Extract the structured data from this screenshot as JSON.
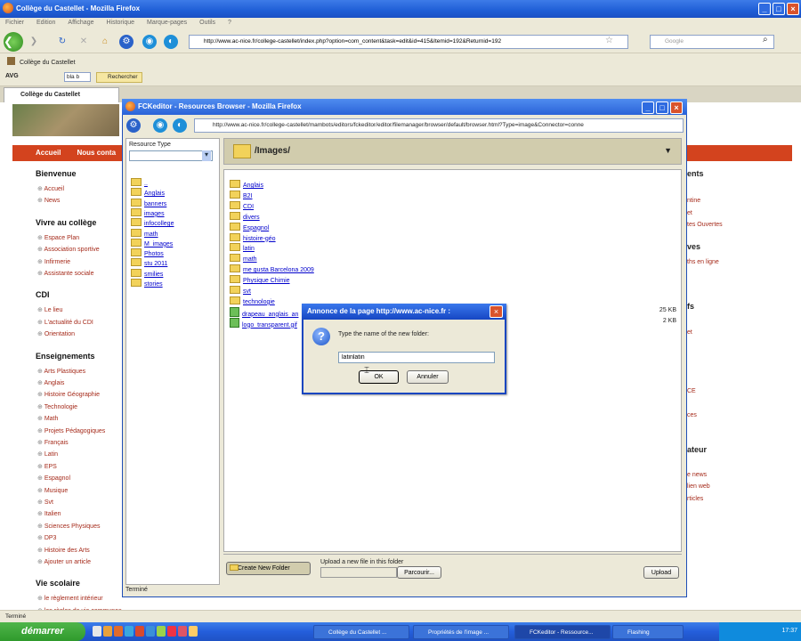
{
  "browser": {
    "title": "Collège du Castellet - Mozilla Firefox",
    "menu": [
      "Fichier",
      "Edition",
      "Affichage",
      "Historique",
      "Marque-pages",
      "Outils",
      "?"
    ],
    "url": "http://www.ac-nice.fr/college-castellet/index.php?option=com_content&task=edit&id=415&Itemid=192&Returnid=192",
    "search_placeholder": "Google",
    "bookmark": "Collège du Castellet",
    "avg_label": "AVG",
    "avg_search_value": "bla b",
    "avg_button": "Rechercher",
    "tab": "Collège du Castellet",
    "status": "Terminé"
  },
  "site": {
    "nav": [
      "Accueil",
      "Nous conta"
    ],
    "sections": [
      {
        "head": "Bienvenue",
        "links": [
          "Accueil",
          "News"
        ]
      },
      {
        "head": "Vivre au collège",
        "links": [
          "Espace Plan",
          "Association sportive",
          "Infirmerie",
          "Assistante sociale"
        ]
      },
      {
        "head": "CDI",
        "links": [
          "Le lieu",
          "L'actualité du CDI",
          "Orientation"
        ]
      },
      {
        "head": "Enseignements",
        "links": [
          "Arts Plastiques",
          "Anglais",
          "Histoire Géographie",
          "Technologie",
          "Math",
          "Projets Pédagogiques",
          "Français",
          "Latin",
          "EPS",
          "Espagnol",
          "Musique",
          "Svt",
          "Italien",
          "Sciences Physiques",
          "DP3",
          "Histoire des Arts",
          "Ajouter un article"
        ]
      },
      {
        "head": "Vie scolaire",
        "links": [
          "le règlement intérieur",
          "les règles de vie communes"
        ]
      }
    ],
    "right": [
      {
        "text": "ents",
        "head": true
      },
      {
        "text": "ntine",
        "head": false
      },
      {
        "text": "et",
        "head": false
      },
      {
        "text": "tes Ouvertes",
        "head": false
      },
      {
        "text": "ves",
        "head": true
      },
      {
        "text": "ths en ligne",
        "head": false
      },
      {
        "text": "fs",
        "head": true
      },
      {
        "text": "et",
        "head": false
      },
      {
        "text": "CE",
        "head": false
      },
      {
        "text": "ces",
        "head": false
      },
      {
        "text": "ateur",
        "head": true
      },
      {
        "text": "e news",
        "head": false
      },
      {
        "text": "lien web",
        "head": false
      },
      {
        "text": "rticles",
        "head": false
      }
    ]
  },
  "fck": {
    "title": "FCKeditor - Resources Browser - Mozilla Firefox",
    "url": "http://www.ac-nice.fr/college-castellet/mambots/editors/fckeditor/editor/filemanager/browser/default/browser.html?Type=image&Connector=conne",
    "resource_type_label": "Resource Type",
    "tree": [
      "..",
      "Anglais",
      "banners",
      "images",
      "infocollege",
      "math",
      "M_images",
      "Photos",
      "stu 2011",
      "smilies",
      "stories"
    ],
    "path": "/Images/",
    "folders": [
      "Anglais",
      "B2I",
      "CDI",
      "divers",
      "Espagnol",
      "histoire-géo",
      "latin",
      "math",
      "me gusta Barcelona 2009",
      "Physique Chimie",
      "svt",
      "technologie"
    ],
    "files": [
      {
        "name": "drapeau_anglais_an",
        "size": "25 KB"
      },
      {
        "name": "logo_transparent.gif",
        "size": "2 KB"
      }
    ],
    "create_folder": "Create New Folder",
    "upload_label": "Upload a new file in this folder",
    "browse": "Parcourir...",
    "upload": "Upload",
    "status": "Terminé"
  },
  "dialog": {
    "title": "Annonce de la page http://www.ac-nice.fr :",
    "message": "Type the name of the new folder:",
    "value": "latinlatin",
    "ok": "OK",
    "cancel": "Annuler"
  },
  "taskbar": {
    "start": "démarrer",
    "tasks": [
      "Collège du Castellet ...",
      "Propriétés de l'image ...",
      "FCKeditor - Ressource...",
      "Flashing"
    ],
    "clock": "17:37"
  }
}
